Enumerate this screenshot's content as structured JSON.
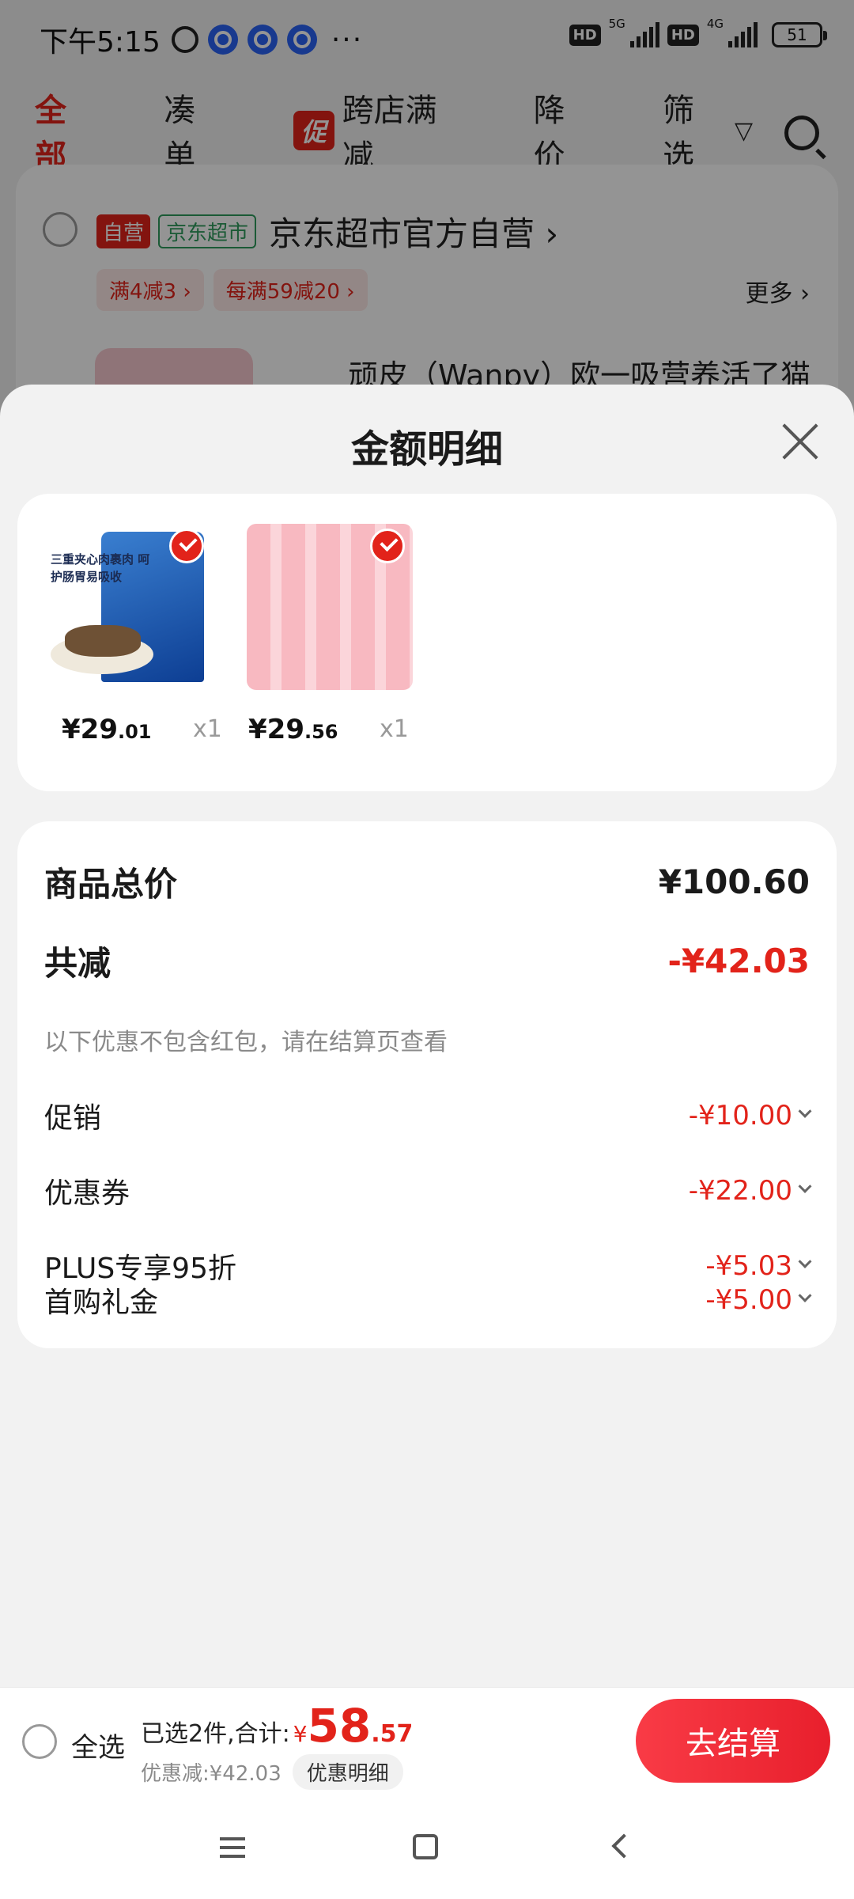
{
  "status_bar": {
    "time": "下午5:15",
    "more": "···",
    "net1": "5G",
    "net2": "4G",
    "hd": "HD",
    "battery": "51"
  },
  "tabs": [
    {
      "label": "全部"
    },
    {
      "label": "凑单"
    },
    {
      "badge": "促",
      "label": "跨店满减"
    },
    {
      "label": "降价"
    },
    {
      "label": "筛选"
    }
  ],
  "store": {
    "tag_self": "自营",
    "tag_mart": "京东超市",
    "name": "京东超市官方自营 ›",
    "promos": [
      "满4减3 ›",
      "每满59减20 ›"
    ],
    "more": "更多 ›",
    "item_title": "顽皮（Wanpy）欧一吸营养活了猫"
  },
  "sheet": {
    "title": "金额明细",
    "items": [
      {
        "price_int": "¥29",
        "price_dec": ".01",
        "qty": "x1",
        "image_text": "三重夹心肉裹肉 呵护肠胃易吸收"
      },
      {
        "price_int": "¥29",
        "price_dec": ".56",
        "qty": "x1"
      }
    ],
    "total_label": "商品总价",
    "total_value": "¥100.60",
    "reduce_label": "共减",
    "reduce_value": "-¥42.03",
    "hint": "以下优惠不包含红包，请在结算页查看",
    "discounts": [
      {
        "label": "促销",
        "value": "-¥10.00"
      },
      {
        "label": "优惠券",
        "value": "-¥22.00"
      },
      {
        "label": "PLUS专享95折",
        "value": "-¥5.03"
      },
      {
        "label": "首购礼金",
        "value": "-¥5.00"
      }
    ]
  },
  "bottom_bar": {
    "select_all": "全选",
    "selected_text": "已选2件,合计:",
    "yen": "¥",
    "sum_int": "58",
    "sum_dec": ".57",
    "discount_text": "优惠减:¥42.03",
    "detail_button": "优惠明细",
    "checkout": "去结算"
  },
  "colors": {
    "accent": "#e2231a",
    "mart_green": "#2f9c5d"
  }
}
